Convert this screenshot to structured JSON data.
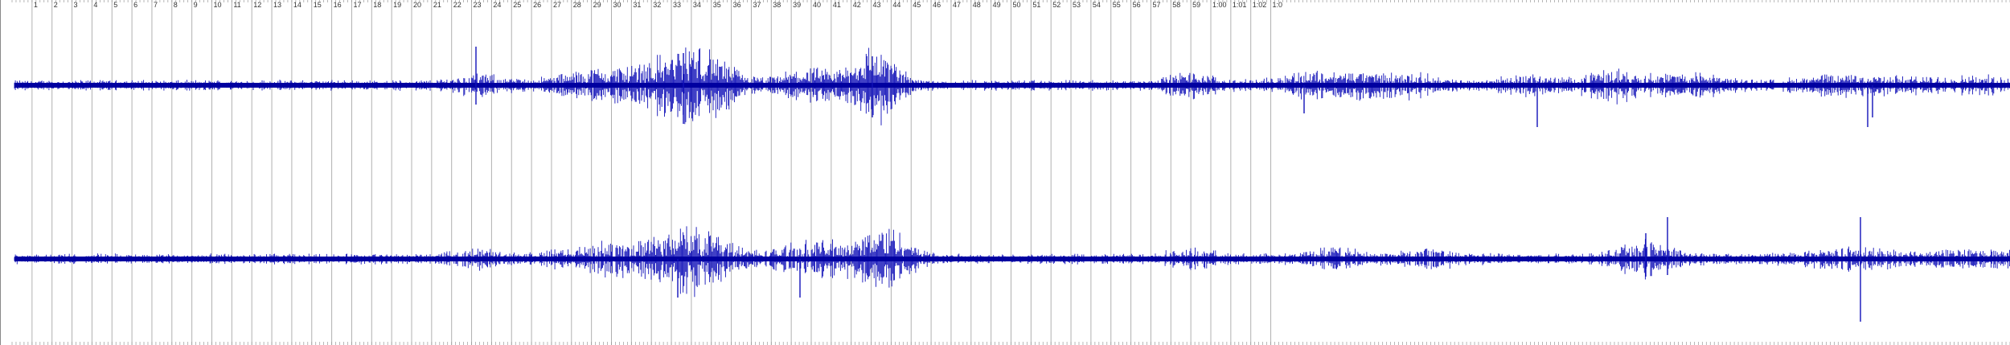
{
  "timeline": {
    "labels": [
      "1",
      "2",
      "3",
      "4",
      "5",
      "6",
      "7",
      "8",
      "9",
      "10",
      "11",
      "12",
      "13",
      "14",
      "15",
      "16",
      "17",
      "18",
      "19",
      "20",
      "21",
      "22",
      "23",
      "24",
      "25",
      "26",
      "27",
      "28",
      "29",
      "30",
      "31",
      "32",
      "33",
      "34",
      "35",
      "36",
      "37",
      "38",
      "39",
      "40",
      "41",
      "42",
      "43",
      "44",
      "45",
      "46",
      "47",
      "48",
      "49",
      "50",
      "51",
      "52",
      "53",
      "54",
      "55",
      "56",
      "57",
      "58",
      "59",
      "1:00",
      "1:01",
      "1:02",
      "1:0"
    ]
  },
  "tracks": [
    {
      "channel": "top"
    },
    {
      "channel": "bottom"
    }
  ],
  "colors": {
    "waveform": "#1010b8",
    "waveform_core": "#0000a0",
    "gridline": "#b0b0b0",
    "background": "#ffffff",
    "label": "#333333"
  }
}
